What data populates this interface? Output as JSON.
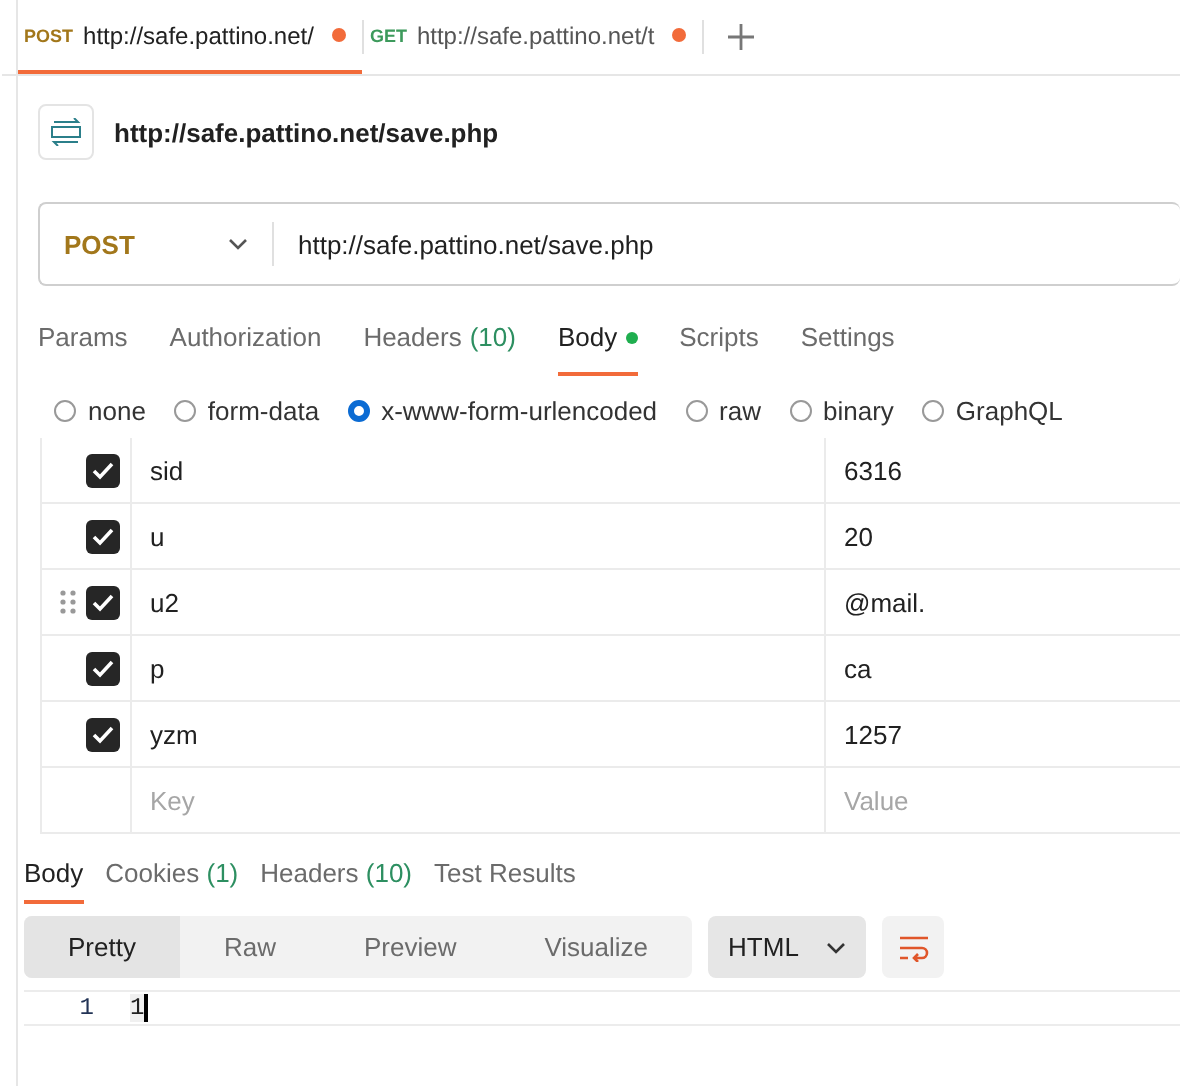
{
  "request_tabs": [
    {
      "method": "POST",
      "title": "http://safe.pattino.net/",
      "selected": true,
      "unsaved": true
    },
    {
      "method": "GET",
      "title": "http://safe.pattino.net/t",
      "selected": false,
      "unsaved": true
    }
  ],
  "request_title": "http://safe.pattino.net/save.php",
  "url_bar": {
    "method": "POST",
    "url": "http://safe.pattino.net/save.php"
  },
  "request_sections": [
    {
      "label": "Params",
      "selected": false
    },
    {
      "label": "Authorization",
      "selected": false
    },
    {
      "label": "Headers",
      "count": "(10)",
      "selected": false
    },
    {
      "label": "Body",
      "selected": true,
      "dot": true
    },
    {
      "label": "Scripts",
      "selected": false
    },
    {
      "label": "Settings",
      "selected": false
    }
  ],
  "body_types": [
    {
      "label": "none",
      "selected": false
    },
    {
      "label": "form-data",
      "selected": false
    },
    {
      "label": "x-www-form-urlencoded",
      "selected": true
    },
    {
      "label": "raw",
      "selected": false
    },
    {
      "label": "binary",
      "selected": false
    },
    {
      "label": "GraphQL",
      "selected": false
    }
  ],
  "params": [
    {
      "key": "sid",
      "value": "6316",
      "checked": true,
      "hovered": false
    },
    {
      "key": "u",
      "value": "20",
      "checked": true,
      "hovered": false
    },
    {
      "key": "u2",
      "value": "@mail.",
      "checked": true,
      "hovered": true
    },
    {
      "key": "p",
      "value": "ca",
      "checked": true,
      "hovered": false
    },
    {
      "key": "yzm",
      "value": "1257",
      "checked": true,
      "hovered": false
    }
  ],
  "new_param": {
    "key_placeholder": "Key",
    "value_placeholder": "Value"
  },
  "response_tabs": [
    {
      "label": "Body",
      "selected": true
    },
    {
      "label": "Cookies",
      "count": "(1)",
      "selected": false
    },
    {
      "label": "Headers",
      "count": "(10)",
      "selected": false
    },
    {
      "label": "Test Results",
      "selected": false
    }
  ],
  "view_modes": [
    {
      "label": "Pretty",
      "selected": true
    },
    {
      "label": "Raw",
      "selected": false
    },
    {
      "label": "Preview",
      "selected": false
    },
    {
      "label": "Visualize",
      "selected": false
    }
  ],
  "format": "HTML",
  "response_lines": [
    {
      "number": "1",
      "text": "1"
    }
  ]
}
